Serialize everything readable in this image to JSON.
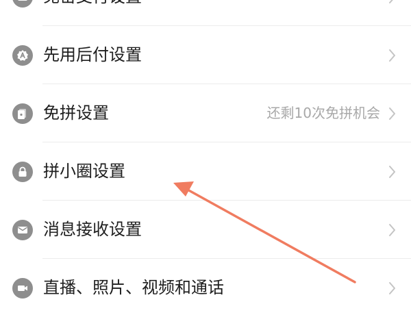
{
  "settings": {
    "items": [
      {
        "label": "免密支付设置",
        "value": "",
        "icon": "wallet-icon"
      },
      {
        "label": "先用后付设置",
        "value": "",
        "icon": "badge-a-icon"
      },
      {
        "label": "免拼设置",
        "value": "还剩10次免拼机会",
        "icon": "card-icon"
      },
      {
        "label": "拼小圈设置",
        "value": "",
        "icon": "lock-icon"
      },
      {
        "label": "消息接收设置",
        "value": "",
        "icon": "message-icon"
      },
      {
        "label": "直播、照片、视频和通话",
        "value": "",
        "icon": "video-icon"
      }
    ]
  },
  "colors": {
    "icon_bg": "#8e8e8e",
    "text": "#1e1e1e",
    "secondary_text": "#a8a8a8",
    "annotation_arrow": "#f07c60"
  }
}
